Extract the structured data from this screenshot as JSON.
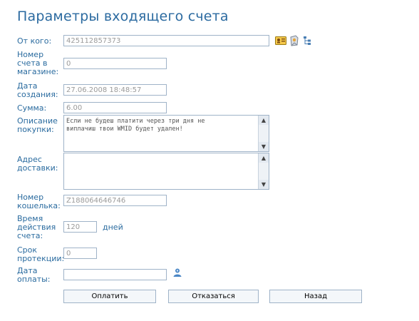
{
  "page": {
    "title": "Параметры входящего счета"
  },
  "form": {
    "from": {
      "label": "От кого:",
      "value": "425112857373"
    },
    "store_invoice": {
      "label_lines": [
        "Номер",
        "счета в",
        "магазине:"
      ],
      "value": "0"
    },
    "created": {
      "label_lines": [
        "Дата",
        "создания:"
      ],
      "value": "27.06.2008 18:48:57"
    },
    "amount": {
      "label": "Сумма:",
      "value": "6.00"
    },
    "description": {
      "label_lines": [
        "Описание",
        "покупки:"
      ],
      "value_lines": [
        "Если не будеш платити через три дня не",
        "виплачиш твои WMID будет удален!"
      ]
    },
    "address": {
      "label_lines": [
        "Адрес",
        "доставки:"
      ],
      "value": ""
    },
    "purse": {
      "label_lines": [
        "Номер",
        "кошелька:"
      ],
      "value": "Z188064646746"
    },
    "validity": {
      "label_lines": [
        "Время",
        "действия",
        "счета:"
      ],
      "value": "120",
      "unit": "дней"
    },
    "protection": {
      "label_lines": [
        "Срок",
        "протекции:"
      ],
      "value": "0"
    },
    "pay_date": {
      "label_lines": [
        "Дата",
        "оплаты:"
      ],
      "value": ""
    }
  },
  "buttons": {
    "pay": "Оплатить",
    "refuse": "Отказаться",
    "back": "Назад"
  },
  "icons": {
    "contact_card": "contact-card-icon",
    "contact_edit": "contact-edit-icon",
    "tree": "tree-icon",
    "calendar_user": "calendar-user-icon"
  },
  "colors": {
    "label": "#2a6b9f",
    "title": "#2b6aa0",
    "border": "#9fb3c8"
  }
}
